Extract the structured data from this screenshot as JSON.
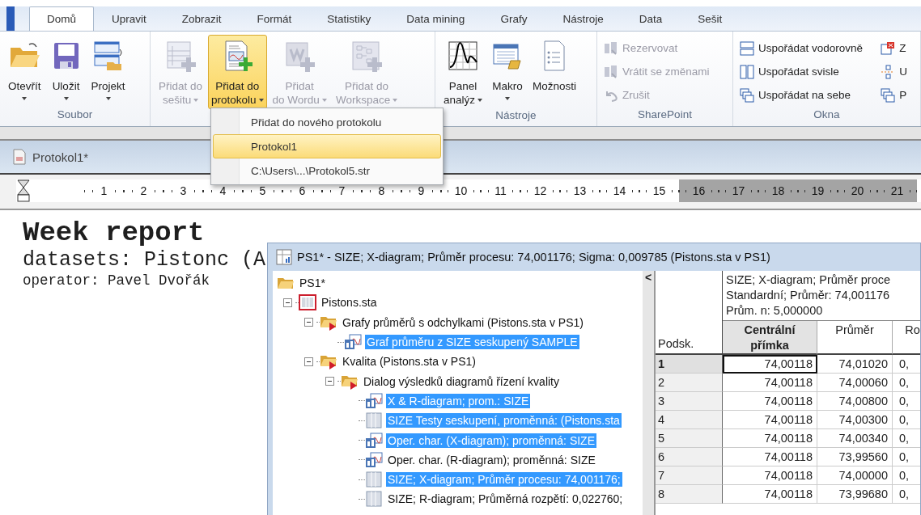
{
  "tabs": [
    {
      "label": "Domů",
      "selected": true
    },
    {
      "label": "Upravit",
      "selected": false
    },
    {
      "label": "Zobrazit",
      "selected": false
    },
    {
      "label": "Formát",
      "selected": false
    },
    {
      "label": "Statistiky",
      "selected": false
    },
    {
      "label": "Data mining",
      "selected": false
    },
    {
      "label": "Grafy",
      "selected": false
    },
    {
      "label": "Nástroje",
      "selected": false
    },
    {
      "label": "Data",
      "selected": false
    },
    {
      "label": "Sešit",
      "selected": false
    }
  ],
  "ribbon": {
    "groups": [
      {
        "label": "Soubor",
        "items": [
          {
            "kind": "large",
            "lines": [
              "Otevřít"
            ],
            "dropdown": true,
            "disabled": false,
            "open": false
          },
          {
            "kind": "large",
            "lines": [
              "Uložit"
            ],
            "dropdown": true,
            "disabled": false,
            "open": false
          },
          {
            "kind": "large",
            "lines": [
              "Projekt"
            ],
            "dropdown": true,
            "disabled": false,
            "open": false
          }
        ]
      },
      {
        "items": [
          {
            "kind": "large",
            "lines": [
              "Přidat do",
              "sešitu"
            ],
            "dropdown": true,
            "disabled": true,
            "open": false
          },
          {
            "kind": "large",
            "lines": [
              "Přidat do",
              "protokolu"
            ],
            "dropdown": true,
            "disabled": false,
            "open": true
          },
          {
            "kind": "large",
            "lines": [
              "Přidat",
              "do Wordu"
            ],
            "dropdown": true,
            "disabled": true,
            "open": false
          },
          {
            "kind": "large",
            "lines": [
              "Přidat do",
              "Workspace"
            ],
            "dropdown": true,
            "disabled": true,
            "open": false
          }
        ]
      },
      {
        "label": "Nástroje",
        "items": [
          {
            "kind": "large",
            "lines": [
              "Panel",
              "analýz"
            ],
            "dropdown": true,
            "disabled": false,
            "open": false
          },
          {
            "kind": "large",
            "lines": [
              "Makro"
            ],
            "dropdown": true,
            "disabled": false,
            "open": false
          },
          {
            "kind": "large",
            "lines": [
              "Možnosti"
            ],
            "dropdown": false,
            "disabled": false,
            "open": false
          }
        ]
      },
      {
        "label": "SharePoint",
        "items": [
          {
            "kind": "small",
            "lines": [
              "Rezervovat"
            ],
            "disabled": true
          },
          {
            "kind": "small",
            "lines": [
              "Vrátit se změnami"
            ],
            "disabled": true
          },
          {
            "kind": "small",
            "lines": [
              "Zrušit"
            ],
            "disabled": true
          }
        ]
      },
      {
        "label": "Okna",
        "items": [
          {
            "kind": "small",
            "lines": [
              "Uspořádat vodorovně"
            ],
            "disabled": false
          },
          {
            "kind": "small",
            "lines": [
              "Uspořádat svisle"
            ],
            "disabled": false
          },
          {
            "kind": "small",
            "lines": [
              "Uspořádat na sebe"
            ],
            "disabled": false
          },
          {
            "kind": "small",
            "lines": [
              "Z"
            ],
            "disabled": false
          },
          {
            "kind": "small",
            "lines": [
              "U"
            ],
            "disabled": false
          },
          {
            "kind": "small",
            "lines": [
              "P"
            ],
            "disabled": false
          }
        ]
      }
    ]
  },
  "menu": {
    "items": [
      {
        "label": "Přidat do nového protokolu",
        "selected": false
      },
      {
        "label": "Protokol1",
        "selected": true
      },
      {
        "label": "C:\\Users\\...\\Protokol5.str",
        "selected": false
      }
    ]
  },
  "document": {
    "title": "Protokol1*",
    "ruler": [
      {
        "label": "1",
        "margin": false
      },
      {
        "label": "2",
        "margin": false
      },
      {
        "label": "3",
        "margin": false
      },
      {
        "label": "4",
        "margin": false
      },
      {
        "label": "5",
        "margin": false
      },
      {
        "label": "6",
        "margin": false
      },
      {
        "label": "7",
        "margin": false
      },
      {
        "label": "8",
        "margin": false
      },
      {
        "label": "9",
        "margin": false
      },
      {
        "label": "10",
        "margin": false
      },
      {
        "label": "11",
        "margin": false
      },
      {
        "label": "12",
        "margin": false
      },
      {
        "label": "13",
        "margin": false
      },
      {
        "label": "14",
        "margin": false
      },
      {
        "label": "15",
        "margin": false
      },
      {
        "label": "16",
        "margin": true
      },
      {
        "label": "17",
        "margin": true
      },
      {
        "label": "18",
        "margin": true
      },
      {
        "label": "19",
        "margin": true
      },
      {
        "label": "20",
        "margin": true
      },
      {
        "label": "21",
        "margin": true
      }
    ],
    "heading": "Week report",
    "lines": [
      "datasets: Pistonc (A",
      "operator: Pavel Dvořák"
    ]
  },
  "workbook": {
    "title": "PS1* - SIZE; X-diagram; Průměr procesu: 74,001176; Sigma: 0,009785 (Pistons.sta v PS1)",
    "tree": [
      {
        "label": "PS1*",
        "kind": "folder",
        "selected": false,
        "children": [
          {
            "label": "Pistons.sta",
            "kind": "dataset",
            "selected": false,
            "expanded": true,
            "children": [
              {
                "label": "Grafy průměrů s odchylkami (Pistons.sta v PS1)",
                "kind": "output-folder",
                "selected": false,
                "expanded": true,
                "children": [
                  {
                    "label": "Graf průměru z SIZE seskupený SAMPLE",
                    "kind": "graph",
                    "selected": true
                  }
                ]
              },
              {
                "label": "Kvalita (Pistons.sta v PS1)",
                "kind": "output-folder",
                "selected": false,
                "expanded": true,
                "children": [
                  {
                    "label": "Dialog výsledků diagramů řízení kvality",
                    "kind": "output-folder",
                    "selected": false,
                    "expanded": true,
                    "children": [
                      {
                        "label": "X & R-diagram; prom.: SIZE",
                        "kind": "graph",
                        "selected": true
                      },
                      {
                        "label": "SIZE Testy seskupení, proměnná: (Pistons.sta",
                        "kind": "sheet",
                        "selected": true
                      },
                      {
                        "label": "Oper. char. (X-diagram); proměnná: SIZE",
                        "kind": "graph",
                        "selected": true
                      },
                      {
                        "label": "Oper. char. (R-diagram); proměnná: SIZE",
                        "kind": "graph",
                        "selected": false
                      },
                      {
                        "label": "SIZE; X-diagram; Průměr procesu: 74,001176;",
                        "kind": "sheet",
                        "selected": true
                      },
                      {
                        "label": "SIZE; R-diagram; Průměrná rozpětí: 0,022760;",
                        "kind": "sheet",
                        "selected": false
                      }
                    ]
                  }
                ]
              }
            ]
          }
        ]
      }
    ],
    "splitter": "<",
    "sheet": {
      "header_lines": [
        "SIZE; X-diagram; Průměr proce",
        "Standardní; Průměr: 74,001176",
        "Prům. n: 5,000000"
      ],
      "row_header_label": "Podsk.",
      "columns": [
        {
          "lines": [
            "Centrální",
            "přímka"
          ],
          "selected": true
        },
        {
          "lines": [
            "Průměr"
          ],
          "selected": false
        },
        {
          "lines": [
            "Ro"
          ],
          "selected": false
        }
      ],
      "rows": [
        {
          "label": "1",
          "selected": true,
          "cells": [
            "74,00118",
            "74,01020",
            "0,"
          ]
        },
        {
          "label": "2",
          "selected": false,
          "cells": [
            "74,00118",
            "74,00060",
            "0,"
          ]
        },
        {
          "label": "3",
          "selected": false,
          "cells": [
            "74,00118",
            "74,00800",
            "0,"
          ]
        },
        {
          "label": "4",
          "selected": false,
          "cells": [
            "74,00118",
            "74,00300",
            "0,"
          ]
        },
        {
          "label": "5",
          "selected": false,
          "cells": [
            "74,00118",
            "74,00340",
            "0,"
          ]
        },
        {
          "label": "6",
          "selected": false,
          "cells": [
            "74,00118",
            "73,99560",
            "0,"
          ]
        },
        {
          "label": "7",
          "selected": false,
          "cells": [
            "74,00118",
            "74,00000",
            "0,"
          ]
        },
        {
          "label": "8",
          "selected": false,
          "cells": [
            "74,00118",
            "73,99680",
            "0,"
          ]
        }
      ]
    }
  }
}
